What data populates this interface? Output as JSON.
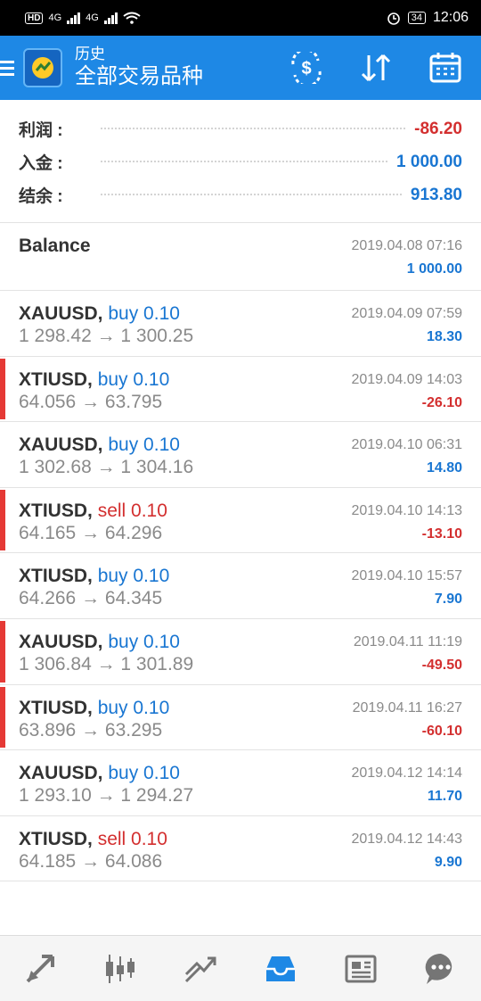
{
  "status": {
    "hd": "HD",
    "net1": "4G",
    "net2": "4G",
    "battery": "34",
    "time": "12:06"
  },
  "toolbar": {
    "title": "历史",
    "subtitle": "全部交易品种"
  },
  "summary": [
    {
      "label": "利润 :",
      "value": "-86.20",
      "tone": "neg"
    },
    {
      "label": "入金 :",
      "value": "1 000.00",
      "tone": "pos"
    },
    {
      "label": "结余 :",
      "value": "913.80",
      "tone": "pos"
    }
  ],
  "balance": {
    "label": "Balance",
    "date": "2019.04.08 07:16",
    "amount": "1 000.00"
  },
  "trades": [
    {
      "symbol": "XAUUSD,",
      "side": "buy 0.10",
      "prices": "1 298.42 → 1 300.25",
      "date": "2019.04.09 07:59",
      "profit": "18.30"
    },
    {
      "symbol": "XTIUSD,",
      "side": "buy 0.10",
      "prices": "64.056 → 63.795",
      "date": "2019.04.09 14:03",
      "profit": "-26.10"
    },
    {
      "symbol": "XAUUSD,",
      "side": "buy 0.10",
      "prices": "1 302.68 → 1 304.16",
      "date": "2019.04.10 06:31",
      "profit": "14.80"
    },
    {
      "symbol": "XTIUSD,",
      "side": "sell 0.10",
      "prices": "64.165 → 64.296",
      "date": "2019.04.10 14:13",
      "profit": "-13.10"
    },
    {
      "symbol": "XTIUSD,",
      "side": "buy 0.10",
      "prices": "64.266 → 64.345",
      "date": "2019.04.10 15:57",
      "profit": "7.90"
    },
    {
      "symbol": "XAUUSD,",
      "side": "buy 0.10",
      "prices": "1 306.84 → 1 301.89",
      "date": "2019.04.11 11:19",
      "profit": "-49.50"
    },
    {
      "symbol": "XTIUSD,",
      "side": "buy 0.10",
      "prices": "63.896 → 63.295",
      "date": "2019.04.11 16:27",
      "profit": "-60.10"
    },
    {
      "symbol": "XAUUSD,",
      "side": "buy 0.10",
      "prices": "1 293.10 → 1 294.27",
      "date": "2019.04.12 14:14",
      "profit": "11.70"
    },
    {
      "symbol": "XTIUSD,",
      "side": "sell 0.10",
      "prices": "64.185 → 64.086",
      "date": "2019.04.12 14:43",
      "profit": "9.90"
    }
  ],
  "colors": {
    "accent": "#1e88e5",
    "loss": "#d32f2f",
    "gain": "#1976d2"
  },
  "nav": [
    "quotes-icon",
    "chart-icon",
    "trade-icon",
    "history-icon",
    "news-icon",
    "chat-icon"
  ]
}
